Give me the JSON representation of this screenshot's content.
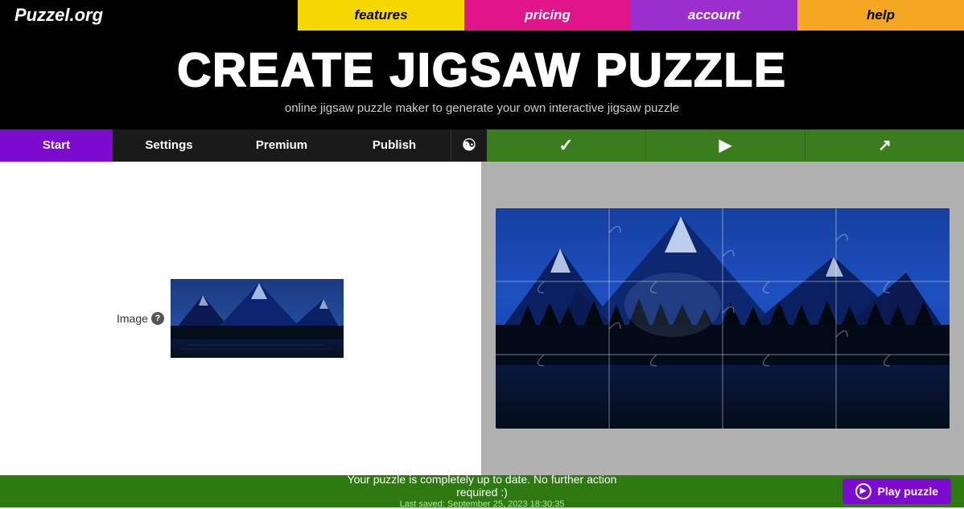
{
  "site": {
    "logo": "Puzzel.org"
  },
  "nav": {
    "features": "features",
    "pricing": "pricing",
    "account": "account",
    "help": "help"
  },
  "hero": {
    "title": "CREATE JIGSAW PUZZLE",
    "subtitle": "online jigsaw puzzle maker to generate your own interactive jigsaw puzzle"
  },
  "tabs": {
    "start": "Start",
    "settings": "Settings",
    "premium": "Premium",
    "publish": "Publish",
    "yin_yang_icon": "☯",
    "check_icon": "✓",
    "play_icon": "▶",
    "share_icon": "↗"
  },
  "left_panel": {
    "image_label": "Image",
    "help_icon": "?"
  },
  "status_bar": {
    "main_text": "Your puzzle is completely up to date. No further action required :)",
    "saved_text": "Last saved: September 25, 2023 18:30:35",
    "play_button": "Play puzzle"
  }
}
